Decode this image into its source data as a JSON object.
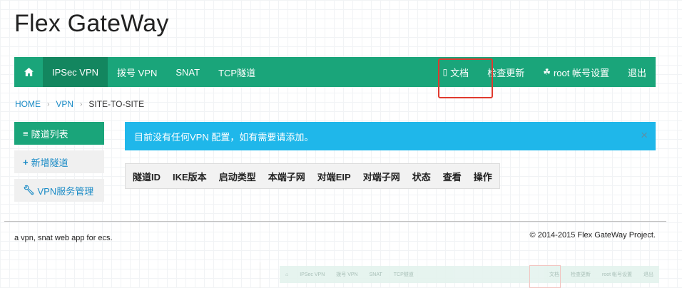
{
  "brand": "Flex GateWay",
  "nav": {
    "home_icon": "home-icon",
    "items": [
      "IPSec VPN",
      "拨号 VPN",
      "SNAT",
      "TCP隧道"
    ],
    "docs": "文档",
    "check_update": "检查更新",
    "account": "root 帐号设置",
    "logout": "退出"
  },
  "breadcrumb": [
    "HOME",
    "VPN",
    "SITE-TO-SITE"
  ],
  "sidebar": {
    "tunnel_list": "隧道列表",
    "add_tunnel": "新增隧道",
    "vpn_service": "VPN服务管理"
  },
  "alert": {
    "message": "目前没有任何VPN 配置，如有需要请添加。",
    "close": "×"
  },
  "table": {
    "headers": [
      "隧道ID",
      "IKE版本",
      "启动类型",
      "本端子网",
      "对端EIP",
      "对端子网",
      "状态",
      "查看",
      "操作"
    ]
  },
  "footer": {
    "left": "a vpn, snat web app for ecs.",
    "right": "© 2014-2015 Flex GateWay Project."
  },
  "preview_nav": [
    "IPSec VPN",
    "拨号 VPN",
    "SNAT",
    "TCP隧道",
    "文档",
    "检查更新",
    "root 帐号设置",
    "退出"
  ],
  "colors": {
    "nav_green": "#1aa57a",
    "nav_active": "#13865f",
    "alert_blue": "#1fb7ea",
    "link_blue": "#1a8bc6",
    "highlight_red": "#e03a2f"
  }
}
